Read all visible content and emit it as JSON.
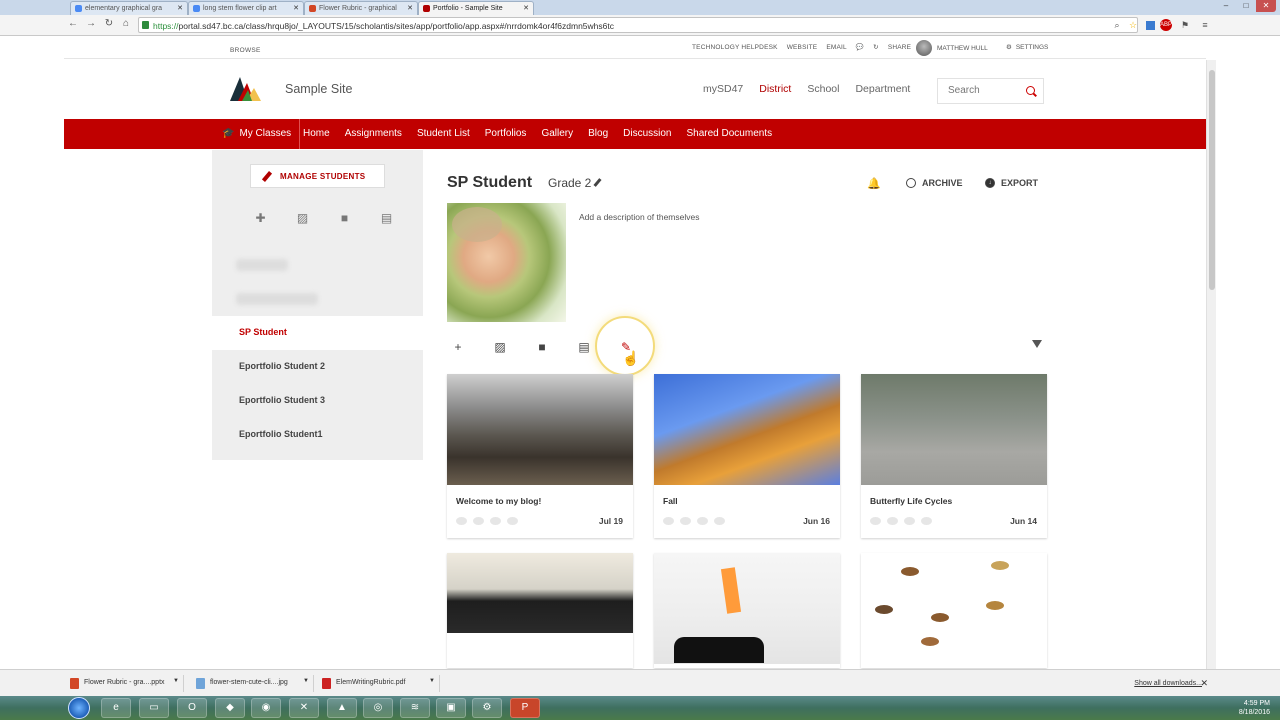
{
  "browser": {
    "tabs": [
      {
        "title": "elementary graphical gra",
        "favicon_color": "#4a8af4"
      },
      {
        "title": "long stem flower clip art",
        "favicon_color": "#4a8af4"
      },
      {
        "title": "Flower Rubric - graphical",
        "favicon_color": "#d24726"
      },
      {
        "title": "Portfolio - Sample Site",
        "favicon_color": "#b00000",
        "active": true
      }
    ],
    "url_scheme": "https://",
    "url_rest": "portal.sd47.bc.ca/class/hrqu8jo/_LAYOUTS/15/scholantis/sites/app/portfolio/app.aspx#/nrrdomk4or4f6zdmn5whs6tc"
  },
  "suitebar": {
    "browse": "BROWSE",
    "links": [
      "TECHNOLOGY HELPDESK",
      "WEBSITE",
      "EMAIL",
      "SHARE"
    ],
    "user": "MATTHEW HULL",
    "settings": "SETTINGS"
  },
  "site": {
    "name": "Sample Site",
    "topnav": [
      "mySD47",
      "District",
      "School",
      "Department"
    ],
    "search_placeholder": "Search"
  },
  "rednav": {
    "my_classes": "My Classes",
    "items": [
      "Home",
      "Assignments",
      "Student List",
      "Portfolios",
      "Gallery",
      "Blog",
      "Discussion",
      "Shared Documents"
    ]
  },
  "left_panel": {
    "manage_label": "MANAGE STUDENTS",
    "students": [
      "SP Student",
      "Eportfolio Student 2",
      "Eportfolio Student 3",
      "Eportfolio Student1"
    ],
    "active_index": 0
  },
  "main": {
    "student_name": "SP Student",
    "grade": "Grade 2",
    "archive_label": "ARCHIVE",
    "export_label": "EXPORT",
    "description_placeholder": "Add a description of themselves",
    "posts": [
      {
        "title": "Welcome to my blog!",
        "date": "Jul 19"
      },
      {
        "title": "Fall",
        "date": "Jun 16"
      },
      {
        "title": "Butterfly Life Cycles",
        "date": "Jun 14"
      },
      {
        "title": "",
        "date": ""
      },
      {
        "title": "",
        "date": ""
      },
      {
        "title": "",
        "date": ""
      }
    ]
  },
  "downloads": {
    "items": [
      "Flower Rubric - gra....pptx",
      "flower-stem-cute-cli....jpg",
      "ElemWritingRubric.pdf"
    ],
    "show_all": "Show all downloads..."
  },
  "taskbar": {
    "time": "4:59 PM",
    "date": "8/18/2016"
  }
}
